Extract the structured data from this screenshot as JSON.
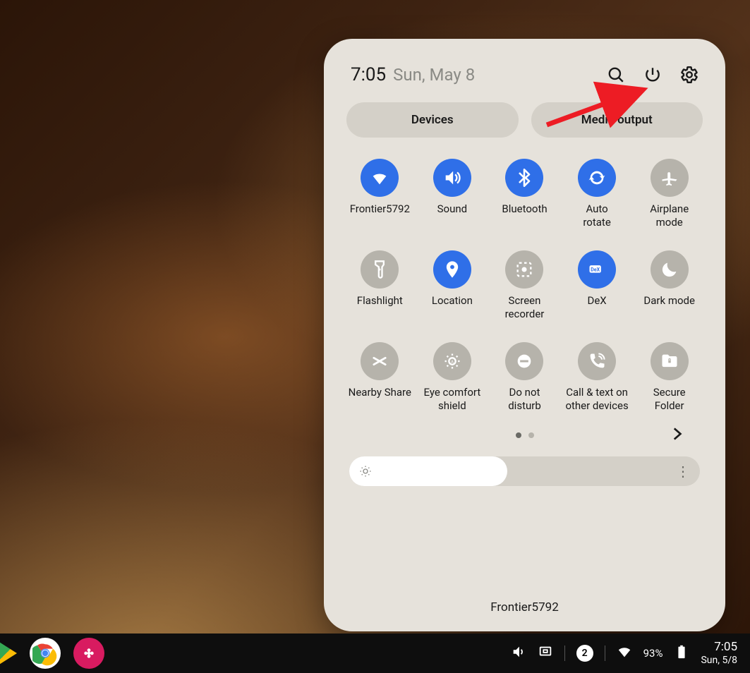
{
  "panel": {
    "time": "7:05",
    "date": "Sun, May 8",
    "pills": {
      "devices": "Devices",
      "media": "Media output"
    },
    "tiles": [
      {
        "id": "wifi",
        "label": "Frontier5792",
        "active": true
      },
      {
        "id": "sound",
        "label": "Sound",
        "active": true
      },
      {
        "id": "bluetooth",
        "label": "Bluetooth",
        "active": true
      },
      {
        "id": "autorotate",
        "label": "Auto\nrotate",
        "active": true
      },
      {
        "id": "airplane",
        "label": "Airplane\nmode",
        "active": false
      },
      {
        "id": "flashlight",
        "label": "Flashlight",
        "active": false
      },
      {
        "id": "location",
        "label": "Location",
        "active": true
      },
      {
        "id": "screenrec",
        "label": "Screen\nrecorder",
        "active": false
      },
      {
        "id": "dex",
        "label": "DeX",
        "active": true
      },
      {
        "id": "darkmode",
        "label": "Dark mode",
        "active": false
      },
      {
        "id": "nearby",
        "label": "Nearby Share",
        "active": false
      },
      {
        "id": "eyecomfort",
        "label": "Eye comfort\nshield",
        "active": false
      },
      {
        "id": "dnd",
        "label": "Do not\ndisturb",
        "active": false
      },
      {
        "id": "calltext",
        "label": "Call & text on\nother devices",
        "active": false
      },
      {
        "id": "securefolder",
        "label": "Secure\nFolder",
        "active": false
      }
    ],
    "brightness_percent": 45,
    "footer_network": "Frontier5792"
  },
  "shelf": {
    "notification_count": "2",
    "battery_text": "93%",
    "clock_time": "7:05",
    "clock_date": "Sun, 5/8"
  },
  "annotation": {
    "arrow_target": "power-icon"
  }
}
